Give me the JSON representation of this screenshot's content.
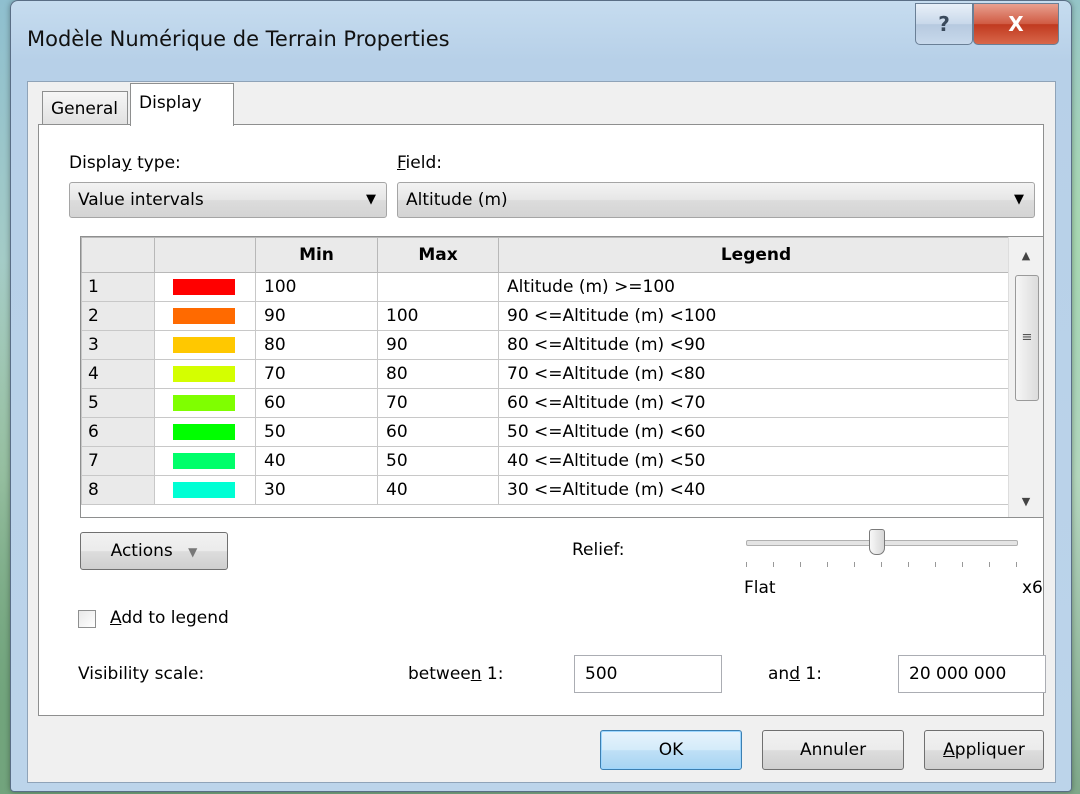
{
  "window": {
    "title": "Modèle Numérique de Terrain Properties",
    "help_glyph": "?",
    "close_glyph": "X"
  },
  "tabs": [
    {
      "label": "General",
      "selected": false
    },
    {
      "label": "Display",
      "selected": true
    }
  ],
  "display_type": {
    "label_pre": "Displa",
    "label_acc": "y",
    "label_post": " type:",
    "value": "Value intervals"
  },
  "field": {
    "label_acc": "F",
    "label_post": "ield:",
    "value": "Altitude (m)"
  },
  "table": {
    "headers": [
      "",
      "",
      "Min",
      "Max",
      "Legend"
    ],
    "rows": [
      {
        "num": "1",
        "color": "#ff0000",
        "min": "100",
        "max": "",
        "legend": "Altitude (m) >=100"
      },
      {
        "num": "2",
        "color": "#ff6a00",
        "min": "90",
        "max": "100",
        "legend": "90 <=Altitude (m) <100"
      },
      {
        "num": "3",
        "color": "#ffc800",
        "min": "80",
        "max": "90",
        "legend": "80 <=Altitude (m) <90"
      },
      {
        "num": "4",
        "color": "#d4ff00",
        "min": "70",
        "max": "80",
        "legend": "70 <=Altitude (m) <80"
      },
      {
        "num": "5",
        "color": "#7fff00",
        "min": "60",
        "max": "70",
        "legend": "60 <=Altitude (m) <70"
      },
      {
        "num": "6",
        "color": "#00ff00",
        "min": "50",
        "max": "60",
        "legend": "50 <=Altitude (m) <60"
      },
      {
        "num": "7",
        "color": "#00ff6a",
        "min": "40",
        "max": "50",
        "legend": "40 <=Altitude (m) <50"
      },
      {
        "num": "8",
        "color": "#00ffd4",
        "min": "30",
        "max": "40",
        "legend": "30 <=Altitude (m) <40"
      }
    ]
  },
  "actions_button": {
    "label": "Actions",
    "arrow": "▼"
  },
  "relief": {
    "label": "Relief:",
    "min_label": "Flat",
    "max_label": "x6",
    "level_fraction": 0.48
  },
  "add_to_legend": {
    "label_acc": "A",
    "label_post": "dd to legend",
    "checked": false
  },
  "visibility": {
    "label": "Visibility scale:",
    "between_pre": "betwee",
    "between_acc": "n",
    "between_post": " 1:",
    "between_value": "500",
    "and_pre": "an",
    "and_acc": "d",
    "and_post": " 1:",
    "and_value": "20 000 000"
  },
  "buttons": {
    "ok": "OK",
    "cancel": "Annuler",
    "apply_acc": "A",
    "apply_post": "ppliquer"
  }
}
